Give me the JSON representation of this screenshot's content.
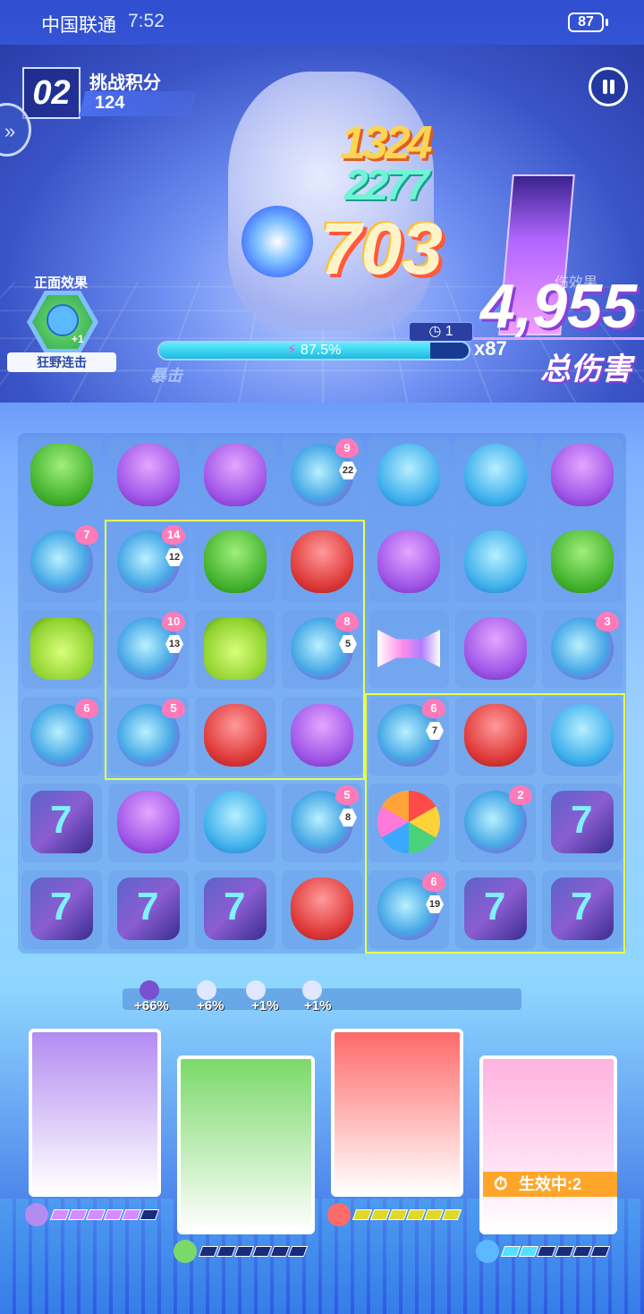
{
  "status_bar": {
    "carrier": "中国联通",
    "time": "7:52",
    "battery": "87"
  },
  "hud": {
    "wave": "02",
    "score_label": "挑战积分",
    "score": "124",
    "damage_numbers": [
      "1324",
      "2277"
    ],
    "damage_big": "703",
    "total_damage": "4,955",
    "total_damage_label": "总伤害",
    "total_ghost_label": "伤效果",
    "buff_title": "正面效果",
    "buff_count": "+1",
    "buff_name": "狂野连击",
    "timer": "1",
    "energy_percent": 87.5,
    "energy_label": "87.5%",
    "combo": "x87",
    "crit_label": "暴击"
  },
  "board": {
    "rows": [
      [
        {
          "t": "green"
        },
        {
          "t": "purple"
        },
        {
          "t": "purple"
        },
        {
          "t": "fish",
          "heart": "9",
          "hex": "22"
        },
        {
          "t": "blue"
        },
        {
          "t": "blue"
        },
        {
          "t": "purple"
        }
      ],
      [
        {
          "t": "fish",
          "heart": "7"
        },
        {
          "t": "fish",
          "heart": "14",
          "hex": "12"
        },
        {
          "t": "green"
        },
        {
          "t": "red"
        },
        {
          "t": "purple"
        },
        {
          "t": "blue"
        },
        {
          "t": "green"
        }
      ],
      [
        {
          "t": "bottle"
        },
        {
          "t": "fish",
          "heart": "10",
          "hex": "13"
        },
        {
          "t": "bottle"
        },
        {
          "t": "fish",
          "heart": "8",
          "hex": "5"
        },
        {
          "t": "ribbon"
        },
        {
          "t": "purple"
        },
        {
          "t": "fish",
          "heart": "3"
        }
      ],
      [
        {
          "t": "fish",
          "heart": "6"
        },
        {
          "t": "fish",
          "heart": "5"
        },
        {
          "t": "red"
        },
        {
          "t": "purple"
        },
        {
          "t": "fish",
          "heart": "6",
          "hex": "7"
        },
        {
          "t": "red"
        },
        {
          "t": "blue"
        }
      ],
      [
        {
          "t": "crystal"
        },
        {
          "t": "purple"
        },
        {
          "t": "blue"
        },
        {
          "t": "fish",
          "heart": "5",
          "hex": "8"
        },
        {
          "t": "ball"
        },
        {
          "t": "fish",
          "heart": "2"
        },
        {
          "t": "crystal"
        }
      ],
      [
        {
          "t": "crystal"
        },
        {
          "t": "crystal"
        },
        {
          "t": "crystal"
        },
        {
          "t": "red"
        },
        {
          "t": "fish",
          "heart": "6",
          "hex": "19"
        },
        {
          "t": "crystal"
        },
        {
          "t": "crystal"
        }
      ]
    ]
  },
  "bonuses": [
    "+66%",
    "+6%",
    "+1%",
    "+1%"
  ],
  "heroes": [
    {
      "name": "hero-cat-ninja",
      "color": "#b38cf2",
      "gauge_color": "#d68cff",
      "filled": 5
    },
    {
      "name": "hero-opera",
      "color": "#7bd96a",
      "gauge_color": "#2a3fa0",
      "filled": 0
    },
    {
      "name": "hero-bear-pilot",
      "color": "#ff6a6a",
      "gauge_color": "#e0d82a",
      "filled": 6
    },
    {
      "name": "hero-pink-girl",
      "color": "#ffb2e0",
      "gauge_color": "#4fe1ff",
      "filled": 2,
      "effect": "生效中:2"
    }
  ]
}
